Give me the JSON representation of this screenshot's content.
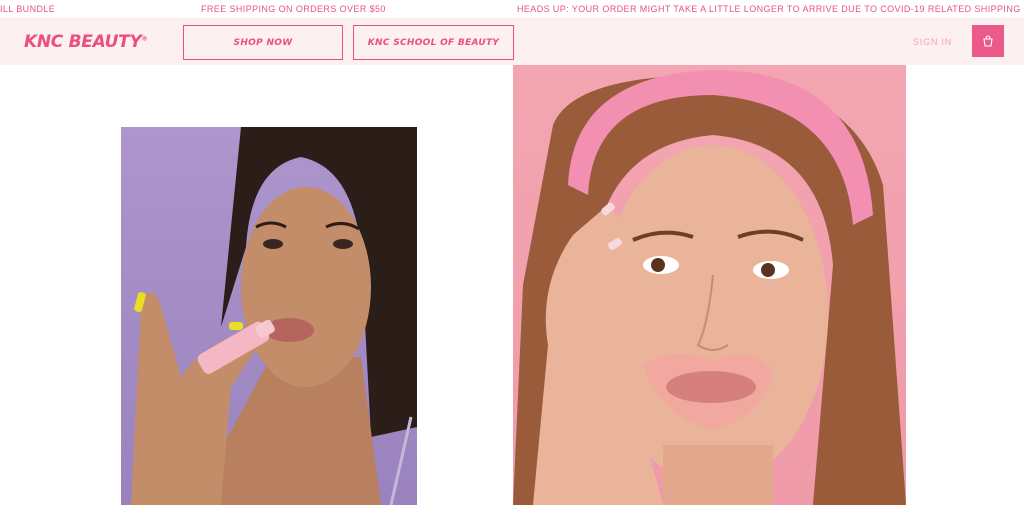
{
  "announcement_bar": {
    "item_1": "ILL BUNDLE",
    "item_2": "FREE SHIPPING ON ORDERS OVER $50",
    "item_3": "HEADS UP: YOUR ORDER MIGHT TAKE A LITTLE LONGER TO ARRIVE DUE TO COVID-19 RELATED SHIPPING DELAYS, BUT"
  },
  "header": {
    "logo": "KNC BEAUTY",
    "logo_mark": "®",
    "nav": {
      "shop_now": "SHOP NOW",
      "school": "KNC SCHOOL OF BEAUTY"
    },
    "sign_in": "SIGN IN",
    "cart_icon": "shopping-bag-icon"
  },
  "colors": {
    "brand_pink": "#ec4d83",
    "header_bg": "#fdf0f1",
    "cart_bg": "#ec5a8b"
  },
  "photos": {
    "left": "model-with-lip-tube-photo",
    "right": "model-with-lip-mask-photo"
  }
}
